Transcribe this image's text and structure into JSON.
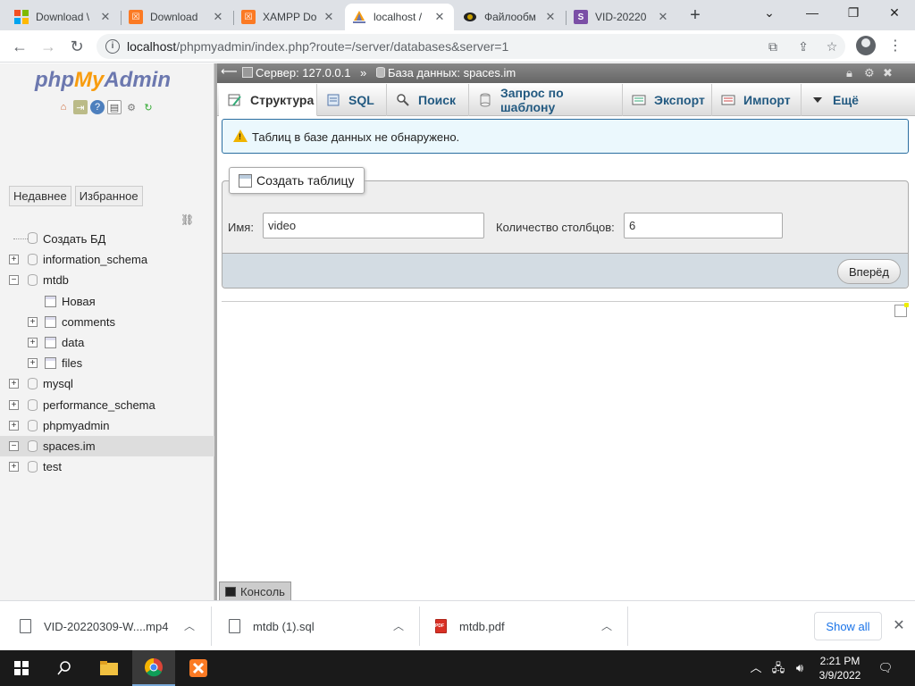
{
  "browser": {
    "tabs": [
      {
        "title": "Download \\",
        "icon": "windows-logo-icon",
        "active": false
      },
      {
        "title": "Download",
        "icon": "xampp-icon",
        "active": false
      },
      {
        "title": "XAMPP Do",
        "icon": "xampp-icon",
        "active": false
      },
      {
        "title": "localhost /",
        "icon": "phpmyadmin-sail-icon",
        "active": true
      },
      {
        "title": "Файлообм",
        "icon": "file-share-icon",
        "active": false
      },
      {
        "title": "VID-20220",
        "icon": "s-site-icon",
        "active": false
      }
    ],
    "url_host": "localhost",
    "url_path": "/phpmyadmin/index.php?route=/server/databases&server=1"
  },
  "pma": {
    "logo": {
      "php": "php",
      "my": "My",
      "admin": "Admin"
    },
    "side_tabs": [
      "Недавнее",
      "Избранное"
    ],
    "tree": [
      {
        "label": "Создать БД",
        "kind": "new-db"
      },
      {
        "label": "information_schema",
        "kind": "db"
      },
      {
        "label": "mtdb",
        "kind": "db-open"
      },
      {
        "label": "Новая",
        "kind": "new-table"
      },
      {
        "label": "comments",
        "kind": "table"
      },
      {
        "label": "data",
        "kind": "table"
      },
      {
        "label": "files",
        "kind": "table"
      },
      {
        "label": "mysql",
        "kind": "db"
      },
      {
        "label": "performance_schema",
        "kind": "db"
      },
      {
        "label": "phpmyadmin",
        "kind": "db"
      },
      {
        "label": "spaces.im",
        "kind": "db-selected"
      },
      {
        "label": "test",
        "kind": "db"
      }
    ],
    "breadcrumb": {
      "server": "Сервер: 127.0.0.1",
      "separator": "»",
      "database": "База данных: spaces.im"
    },
    "menu_tabs": [
      "Структура",
      "SQL",
      "Поиск",
      "Запрос по шаблону",
      "Экспорт",
      "Импорт",
      "Ещё"
    ],
    "notice": "Таблиц в базе данных не обнаружено.",
    "create_table": {
      "legend": "Создать таблицу",
      "name_label": "Имя:",
      "name_value": "video",
      "columns_label": "Количество столбцов:",
      "columns_value": "6",
      "go_label": "Вперёд"
    },
    "console_label": "Консоль"
  },
  "downloads": {
    "items": [
      {
        "name": "VID-20220309-W....mp4",
        "icon": "video-file-icon"
      },
      {
        "name": "mtdb (1).sql",
        "icon": "file-icon"
      },
      {
        "name": "mtdb.pdf",
        "icon": "pdf-icon"
      }
    ],
    "show_all": "Show all"
  },
  "taskbar": {
    "time": "2:21 PM",
    "date": "3/9/2022"
  }
}
